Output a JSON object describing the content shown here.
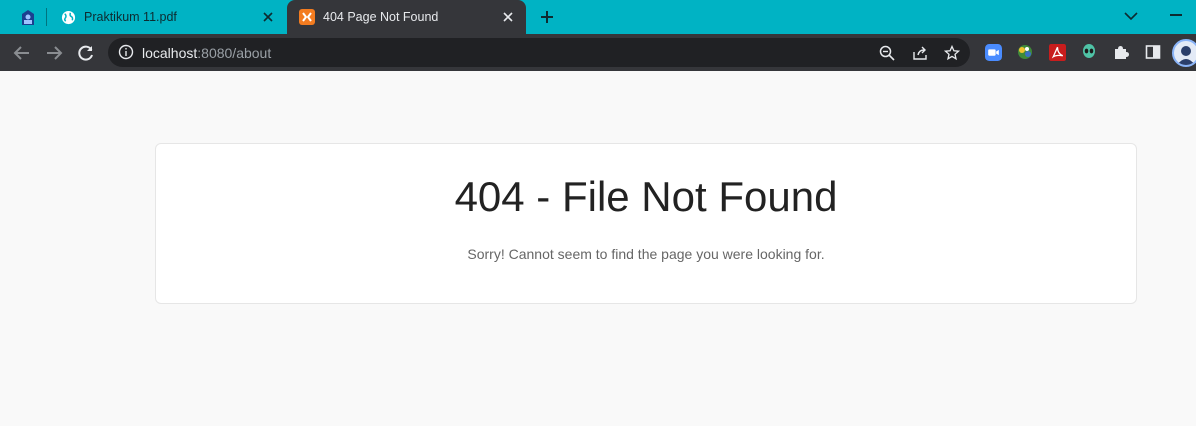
{
  "browser": {
    "tabs": [
      {
        "title": "Praktikum 11.pdf",
        "icon": "globe-icon",
        "active": false
      },
      {
        "title": "404 Page Not Found",
        "icon": "xampp-icon",
        "active": true
      }
    ],
    "address": {
      "host": "localhost",
      "rest": ":8080/about"
    },
    "colors": {
      "tabstrip": "#00b3c4",
      "toolbar": "#35363a",
      "omnibox": "#202124"
    }
  },
  "page": {
    "heading": "404 - File Not Found",
    "message": "Sorry! Cannot seem to find the page you were looking for."
  }
}
